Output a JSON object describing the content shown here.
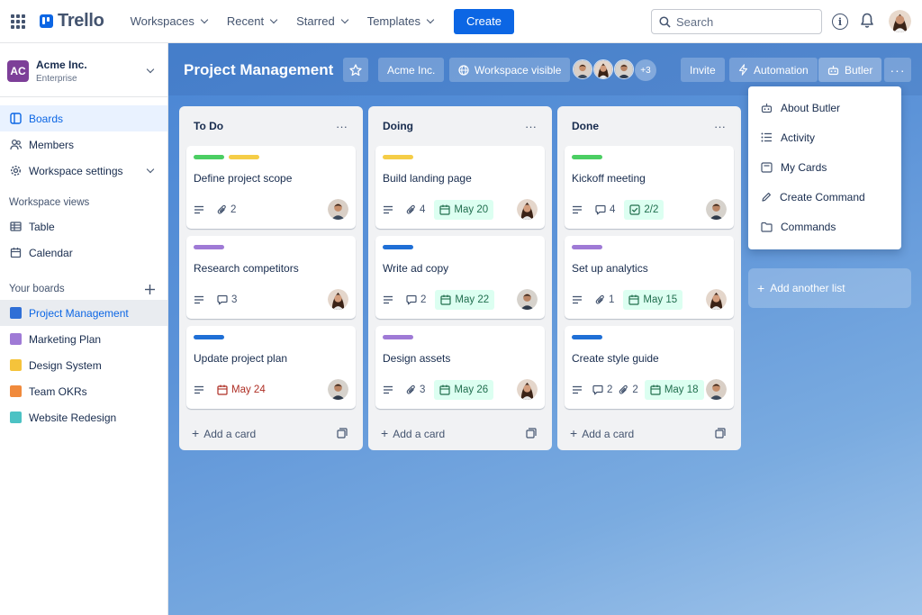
{
  "app": {
    "name": "Trello"
  },
  "topnav": {
    "menus": [
      {
        "label": "Workspaces"
      },
      {
        "label": "Recent"
      },
      {
        "label": "Starred"
      },
      {
        "label": "Templates"
      }
    ],
    "create_label": "Create",
    "search_placeholder": "Search"
  },
  "sidebar": {
    "workspace": {
      "initials": "AC",
      "name": "Acme Inc.",
      "plan": "Enterprise"
    },
    "nav": [
      {
        "label": "Boards",
        "icon": "board-icon"
      },
      {
        "label": "Members",
        "icon": "members-icon"
      },
      {
        "label": "Workspace settings",
        "icon": "gear-icon"
      }
    ],
    "views_heading": "Workspace views",
    "views": [
      {
        "label": "Table",
        "icon": "table-icon"
      },
      {
        "label": "Calendar",
        "icon": "calendar-icon"
      }
    ],
    "boards_heading": "Your boards",
    "boards": [
      {
        "label": "Project Management",
        "color": "#2f6fd6"
      },
      {
        "label": "Marketing Plan",
        "color": "#9f7ad6"
      },
      {
        "label": "Design System",
        "color": "#f5c33b"
      },
      {
        "label": "Team OKRs",
        "color": "#f08a3c"
      },
      {
        "label": "Website Redesign",
        "color": "#4cc2c4"
      }
    ]
  },
  "board": {
    "title": "Project Management",
    "workspace_label": "Acme Inc.",
    "visibility_label": "Workspace visible",
    "extra_members": "+3",
    "invite_label": "Invite",
    "automation_label": "Automation",
    "butler_label": "Butler",
    "add_list_label": "Add another list",
    "lists": [
      {
        "title": "To Do",
        "add_label": "Add a card",
        "cards": [
          {
            "title": "Define project scope",
            "labels": [
              "#4bce63",
              "#f5cd47"
            ],
            "attachments": "2"
          },
          {
            "title": "Research competitors",
            "labels": [
              "#9f7ad6"
            ],
            "comments": "3"
          },
          {
            "title": "Update project plan",
            "labels": [
              "#1f6fd6"
            ],
            "due": "May 24"
          }
        ]
      },
      {
        "title": "Doing",
        "add_label": "Add a card",
        "cards": [
          {
            "title": "Build landing page",
            "labels": [
              "#f5cd47"
            ],
            "attachments": "4",
            "due": "May 20"
          },
          {
            "title": "Write ad copy",
            "labels": [
              "#1f6fd6"
            ],
            "comments": "2",
            "due": "May 22"
          },
          {
            "title": "Design assets",
            "labels": [
              "#9f7ad6"
            ],
            "attachments": "3",
            "due": "May 26"
          }
        ]
      },
      {
        "title": "Done",
        "add_label": "Add a card",
        "cards": [
          {
            "title": "Kickoff meeting",
            "labels": [
              "#4bce63"
            ],
            "comments": "4",
            "checklist": "2/2"
          },
          {
            "title": "Set up analytics",
            "labels": [
              "#9f7ad6"
            ],
            "attachments": "1",
            "due": "May 15"
          },
          {
            "title": "Create style guide",
            "labels": [
              "#1f6fd6"
            ],
            "comments": "2",
            "attachments": "2",
            "due": "May 18"
          }
        ]
      }
    ]
  },
  "butler_menu": {
    "items": [
      {
        "label": "About Butler",
        "icon": "robot-icon"
      },
      {
        "label": "Activity",
        "icon": "list-icon"
      },
      {
        "label": "My Cards",
        "icon": "card-icon"
      },
      {
        "label": "Create Command",
        "icon": "pencil-icon"
      },
      {
        "label": "Commands",
        "icon": "folder-icon"
      }
    ]
  }
}
